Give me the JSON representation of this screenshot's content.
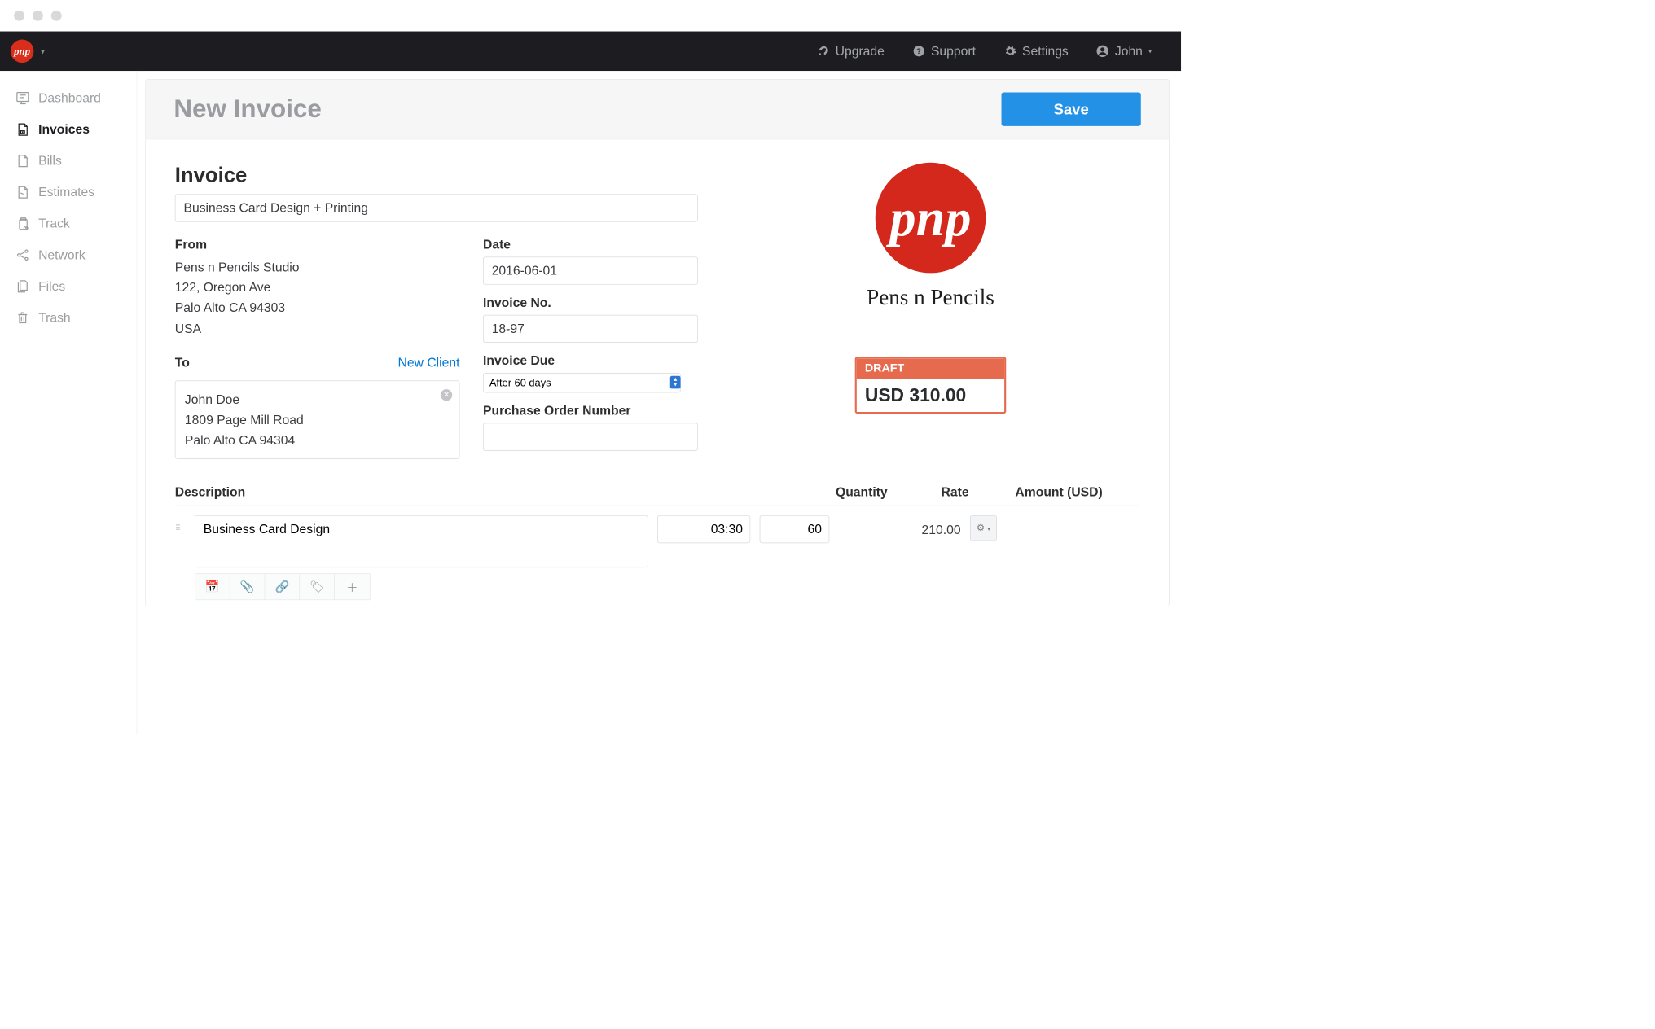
{
  "topbar": {
    "upgrade": "Upgrade",
    "support": "Support",
    "settings": "Settings",
    "user": "John"
  },
  "sidebar": {
    "items": [
      {
        "label": "Dashboard"
      },
      {
        "label": "Invoices"
      },
      {
        "label": "Bills"
      },
      {
        "label": "Estimates"
      },
      {
        "label": "Track"
      },
      {
        "label": "Network"
      },
      {
        "label": "Files"
      },
      {
        "label": "Trash"
      }
    ]
  },
  "page": {
    "title": "New Invoice",
    "save_label": "Save"
  },
  "invoice": {
    "heading": "Invoice",
    "title_value": "Business Card Design + Printing",
    "from_label": "From",
    "from_lines": [
      "Pens n Pencils Studio",
      "122, Oregon Ave",
      "Palo Alto CA 94303",
      "USA"
    ],
    "to_label": "To",
    "new_client": "New Client",
    "to_lines": [
      "John Doe",
      "1809 Page Mill Road",
      "Palo Alto CA 94304"
    ],
    "date_label": "Date",
    "date_value": "2016-06-01",
    "invno_label": "Invoice No.",
    "invno_value": "18-97",
    "due_label": "Invoice Due",
    "due_value": "After 60 days",
    "pon_label": "Purchase Order Number",
    "pon_value": "",
    "brand_label": "Pens n Pencils",
    "status_label": "DRAFT",
    "total": "USD 310.00"
  },
  "lineitems": {
    "headers": {
      "desc": "Description",
      "qty": "Quantity",
      "rate": "Rate",
      "amount": "Amount (USD)"
    },
    "rows": [
      {
        "description": "Business Card Design",
        "quantity": "03:30",
        "rate": "60",
        "amount": "210.00"
      }
    ]
  }
}
